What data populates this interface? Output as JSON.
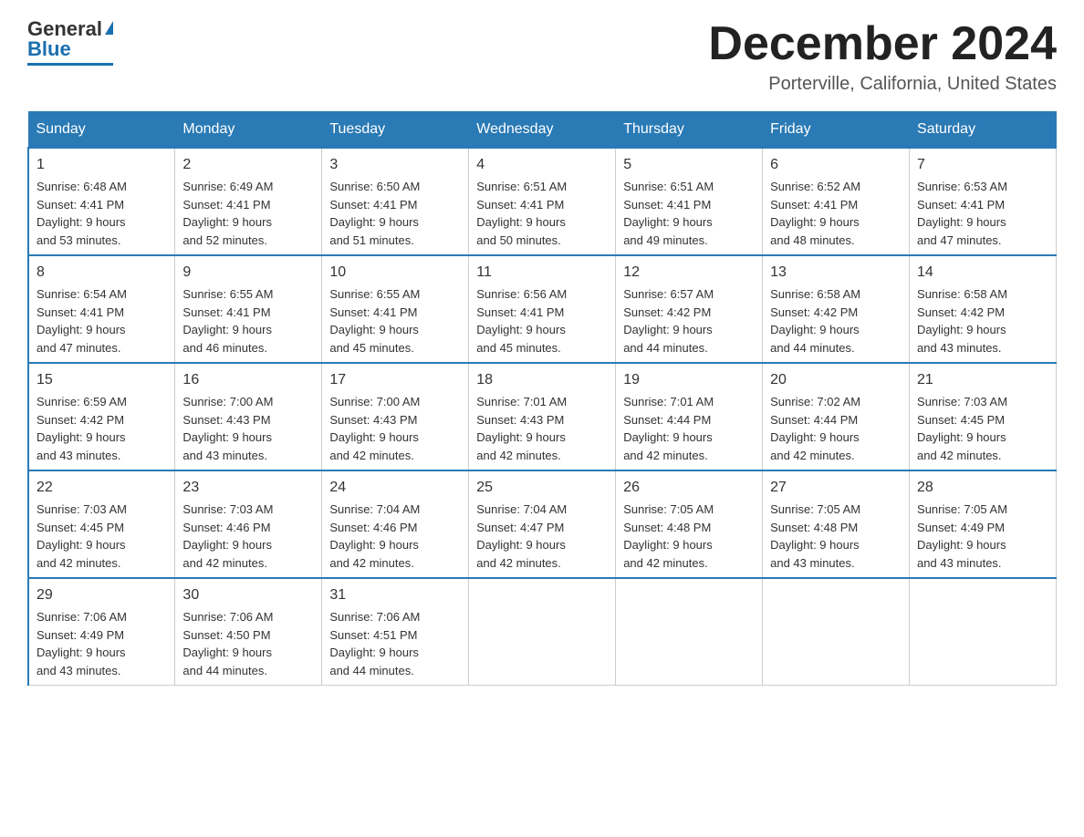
{
  "header": {
    "logo_general": "General",
    "logo_blue": "Blue",
    "month_title": "December 2024",
    "location": "Porterville, California, United States"
  },
  "days_of_week": [
    "Sunday",
    "Monday",
    "Tuesday",
    "Wednesday",
    "Thursday",
    "Friday",
    "Saturday"
  ],
  "weeks": [
    [
      {
        "day": "1",
        "sunrise": "6:48 AM",
        "sunset": "4:41 PM",
        "daylight": "9 hours and 53 minutes."
      },
      {
        "day": "2",
        "sunrise": "6:49 AM",
        "sunset": "4:41 PM",
        "daylight": "9 hours and 52 minutes."
      },
      {
        "day": "3",
        "sunrise": "6:50 AM",
        "sunset": "4:41 PM",
        "daylight": "9 hours and 51 minutes."
      },
      {
        "day": "4",
        "sunrise": "6:51 AM",
        "sunset": "4:41 PM",
        "daylight": "9 hours and 50 minutes."
      },
      {
        "day": "5",
        "sunrise": "6:51 AM",
        "sunset": "4:41 PM",
        "daylight": "9 hours and 49 minutes."
      },
      {
        "day": "6",
        "sunrise": "6:52 AM",
        "sunset": "4:41 PM",
        "daylight": "9 hours and 48 minutes."
      },
      {
        "day": "7",
        "sunrise": "6:53 AM",
        "sunset": "4:41 PM",
        "daylight": "9 hours and 47 minutes."
      }
    ],
    [
      {
        "day": "8",
        "sunrise": "6:54 AM",
        "sunset": "4:41 PM",
        "daylight": "9 hours and 47 minutes."
      },
      {
        "day": "9",
        "sunrise": "6:55 AM",
        "sunset": "4:41 PM",
        "daylight": "9 hours and 46 minutes."
      },
      {
        "day": "10",
        "sunrise": "6:55 AM",
        "sunset": "4:41 PM",
        "daylight": "9 hours and 45 minutes."
      },
      {
        "day": "11",
        "sunrise": "6:56 AM",
        "sunset": "4:41 PM",
        "daylight": "9 hours and 45 minutes."
      },
      {
        "day": "12",
        "sunrise": "6:57 AM",
        "sunset": "4:42 PM",
        "daylight": "9 hours and 44 minutes."
      },
      {
        "day": "13",
        "sunrise": "6:58 AM",
        "sunset": "4:42 PM",
        "daylight": "9 hours and 44 minutes."
      },
      {
        "day": "14",
        "sunrise": "6:58 AM",
        "sunset": "4:42 PM",
        "daylight": "9 hours and 43 minutes."
      }
    ],
    [
      {
        "day": "15",
        "sunrise": "6:59 AM",
        "sunset": "4:42 PM",
        "daylight": "9 hours and 43 minutes."
      },
      {
        "day": "16",
        "sunrise": "7:00 AM",
        "sunset": "4:43 PM",
        "daylight": "9 hours and 43 minutes."
      },
      {
        "day": "17",
        "sunrise": "7:00 AM",
        "sunset": "4:43 PM",
        "daylight": "9 hours and 42 minutes."
      },
      {
        "day": "18",
        "sunrise": "7:01 AM",
        "sunset": "4:43 PM",
        "daylight": "9 hours and 42 minutes."
      },
      {
        "day": "19",
        "sunrise": "7:01 AM",
        "sunset": "4:44 PM",
        "daylight": "9 hours and 42 minutes."
      },
      {
        "day": "20",
        "sunrise": "7:02 AM",
        "sunset": "4:44 PM",
        "daylight": "9 hours and 42 minutes."
      },
      {
        "day": "21",
        "sunrise": "7:03 AM",
        "sunset": "4:45 PM",
        "daylight": "9 hours and 42 minutes."
      }
    ],
    [
      {
        "day": "22",
        "sunrise": "7:03 AM",
        "sunset": "4:45 PM",
        "daylight": "9 hours and 42 minutes."
      },
      {
        "day": "23",
        "sunrise": "7:03 AM",
        "sunset": "4:46 PM",
        "daylight": "9 hours and 42 minutes."
      },
      {
        "day": "24",
        "sunrise": "7:04 AM",
        "sunset": "4:46 PM",
        "daylight": "9 hours and 42 minutes."
      },
      {
        "day": "25",
        "sunrise": "7:04 AM",
        "sunset": "4:47 PM",
        "daylight": "9 hours and 42 minutes."
      },
      {
        "day": "26",
        "sunrise": "7:05 AM",
        "sunset": "4:48 PM",
        "daylight": "9 hours and 42 minutes."
      },
      {
        "day": "27",
        "sunrise": "7:05 AM",
        "sunset": "4:48 PM",
        "daylight": "9 hours and 43 minutes."
      },
      {
        "day": "28",
        "sunrise": "7:05 AM",
        "sunset": "4:49 PM",
        "daylight": "9 hours and 43 minutes."
      }
    ],
    [
      {
        "day": "29",
        "sunrise": "7:06 AM",
        "sunset": "4:49 PM",
        "daylight": "9 hours and 43 minutes."
      },
      {
        "day": "30",
        "sunrise": "7:06 AM",
        "sunset": "4:50 PM",
        "daylight": "9 hours and 44 minutes."
      },
      {
        "day": "31",
        "sunrise": "7:06 AM",
        "sunset": "4:51 PM",
        "daylight": "9 hours and 44 minutes."
      },
      null,
      null,
      null,
      null
    ]
  ],
  "labels": {
    "sunrise": "Sunrise:",
    "sunset": "Sunset:",
    "daylight": "Daylight:"
  }
}
